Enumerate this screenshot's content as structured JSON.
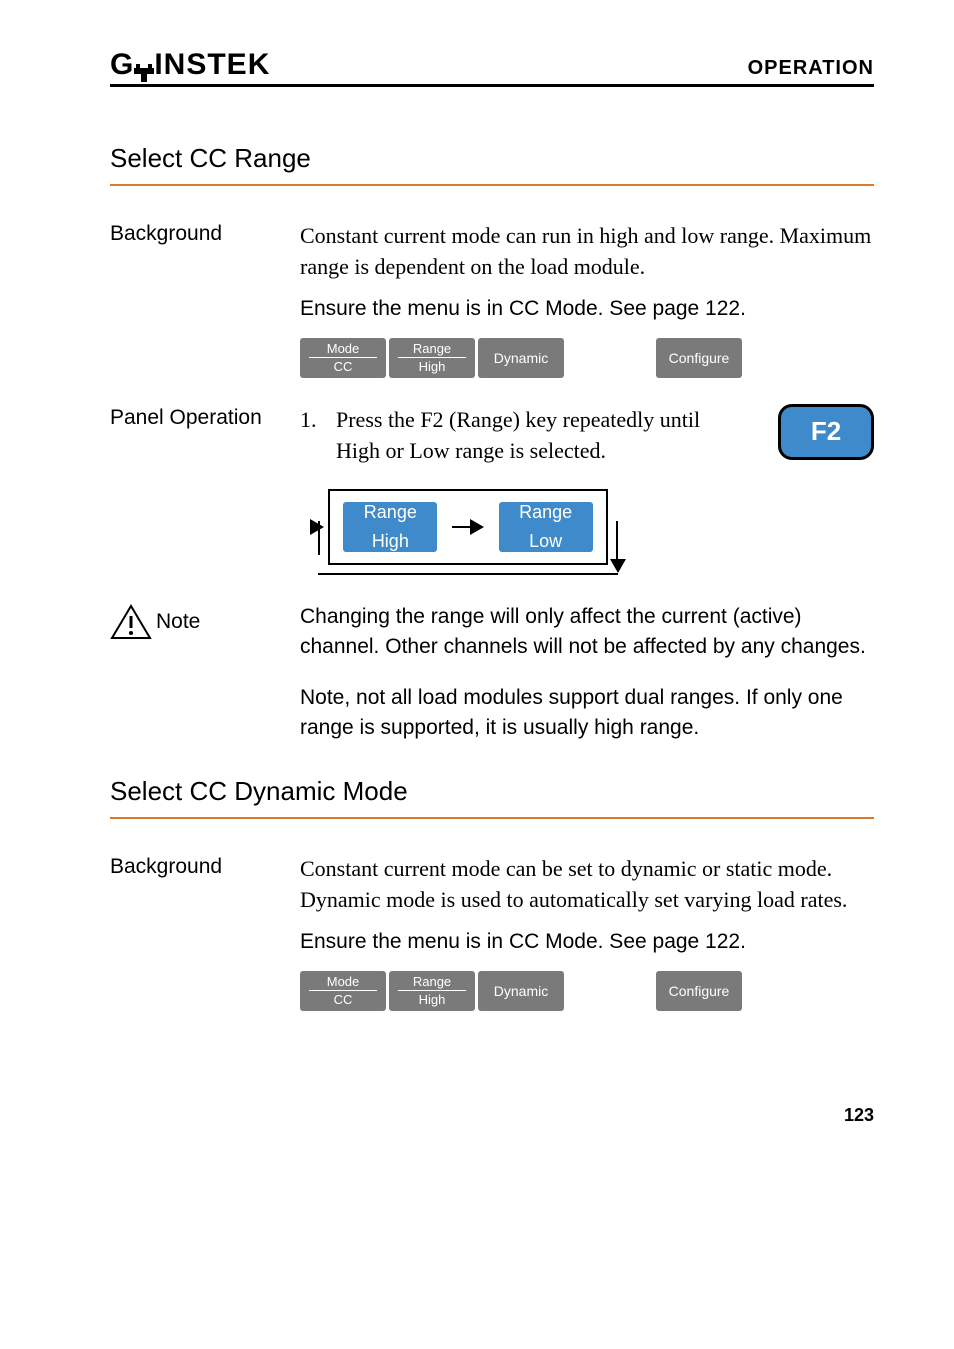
{
  "header": {
    "logo_left": "G",
    "logo_right": "INSTEK",
    "section": "OPERATION"
  },
  "section1": {
    "title": "Select CC Range",
    "background_label": "Background",
    "background_text": "Constant current mode can run in high and low range. Maximum range is dependent on the load module.",
    "ensure_text": "Ensure the menu is in CC Mode. See page 122.",
    "menu": {
      "mode_top": "Mode",
      "mode_bottom": "CC",
      "range_top": "Range",
      "range_bottom": "High",
      "dynamic": "Dynamic",
      "configure": "Configure"
    },
    "panel_label": "Panel Operation",
    "step_num": "1.",
    "step_text": "Press the F2 (Range) key repeatedly until High or Low range is selected.",
    "f2": "F2",
    "range_chip": {
      "label": "Range",
      "high": "High",
      "low": "Low"
    },
    "note_label": "Note",
    "note_p1": "Changing the range will only affect the current (active) channel. Other channels will not be affected by any changes.",
    "note_p2": "Note, not all load modules support dual ranges. If only one range is supported, it is usually high range."
  },
  "section2": {
    "title": "Select CC Dynamic Mode",
    "background_label": "Background",
    "background_text": "Constant current mode can be set to dynamic or static mode. Dynamic mode is used to automatically set varying load rates.",
    "ensure_text": "Ensure the menu is in CC Mode. See page 122.",
    "menu": {
      "mode_top": "Mode",
      "mode_bottom": "CC",
      "range_top": "Range",
      "range_bottom": "High",
      "dynamic": "Dynamic",
      "configure": "Configure"
    }
  },
  "page_number": "123"
}
